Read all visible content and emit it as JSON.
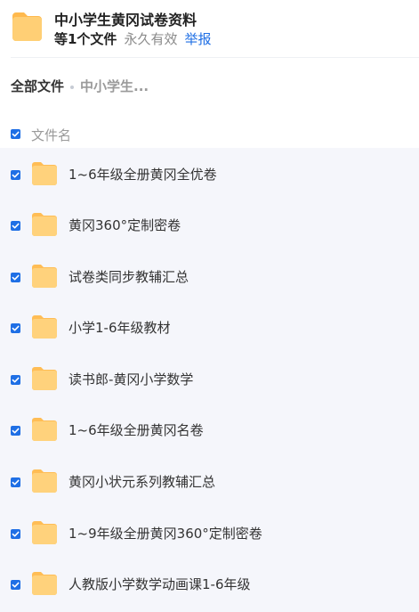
{
  "share": {
    "title": "中小学生黄冈试卷资料",
    "file_count": "等1个文件",
    "validity": "永久有效",
    "report_label": "举报"
  },
  "breadcrumb": {
    "root": "全部文件",
    "current": "中小学生..."
  },
  "list": {
    "column_name": "文件名",
    "items": [
      {
        "name": "1~6年级全册黄冈全优卷"
      },
      {
        "name": "黄冈360°定制密卷"
      },
      {
        "name": "试卷类同步教辅汇总"
      },
      {
        "name": "小学1-6年级教材"
      },
      {
        "name": "读书郎-黄冈小学数学"
      },
      {
        "name": "1~6年级全册黄冈名卷"
      },
      {
        "name": "黄冈小状元系列教辅汇总"
      },
      {
        "name": "1~9年级全册黄冈360°定制密卷"
      },
      {
        "name": "人教版小学数学动画课1-6年级"
      }
    ]
  },
  "icons": {
    "folder": "folder-icon",
    "checkbox": "checkbox-checked-icon"
  },
  "colors": {
    "accent": "#1f6fe5",
    "folder": "#ffc661",
    "list_background": "#f5f6fb"
  }
}
